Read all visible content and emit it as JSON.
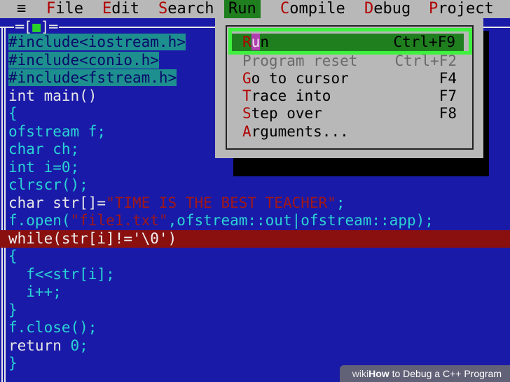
{
  "menubar": {
    "system": "≡",
    "items": [
      {
        "hk": "F",
        "rest": "ile"
      },
      {
        "hk": "E",
        "rest": "dit"
      },
      {
        "hk": "S",
        "rest": "earch"
      },
      {
        "hk": "R",
        "rest": "un"
      },
      {
        "hk": "C",
        "rest": "ompile"
      },
      {
        "hk": "D",
        "rest": "ebug"
      },
      {
        "hk": "P",
        "rest": "roject"
      }
    ]
  },
  "window": {
    "control_left": "═[",
    "control_box": "■",
    "control_right": "]═"
  },
  "code_lines": [
    "#include<iostream.h>",
    "#include<conio.h>",
    "#include<fstream.h>",
    "int main()",
    "{",
    "ofstream f;",
    "char ch;",
    "int i=0;",
    "clrscr();",
    "char str[]=",
    "\"TIME IS THE BEST TEACHER\"",
    ";",
    "f.open(",
    "\"file1.txt\"",
    ",ofstream::out|ofstream::app);",
    "while(str[i]!='\\0')",
    "{",
    "  f<<str[i];",
    "  i++;",
    "}",
    "f.close();",
    "return ",
    "0",
    ";",
    "}"
  ],
  "run_menu": {
    "items": [
      {
        "hk": "R",
        "mid": "u",
        "rest": "n",
        "shortcut": "Ctrl+F9"
      },
      {
        "hk": "",
        "mid": "",
        "rest": "Program reset",
        "shortcut": "Ctrl+F2"
      },
      {
        "hk": "G",
        "mid": "",
        "rest": "o to cursor",
        "shortcut": "F4"
      },
      {
        "hk": "T",
        "mid": "",
        "rest": "race into",
        "shortcut": "F7"
      },
      {
        "hk": "S",
        "mid": "",
        "rest": "tep over",
        "shortcut": "F8"
      },
      {
        "hk": "A",
        "mid": "",
        "rest": "rguments...",
        "shortcut": ""
      }
    ]
  },
  "watermark": {
    "brand": "wiki",
    "title": "How",
    "rest": " to Debug a C++ Program"
  }
}
